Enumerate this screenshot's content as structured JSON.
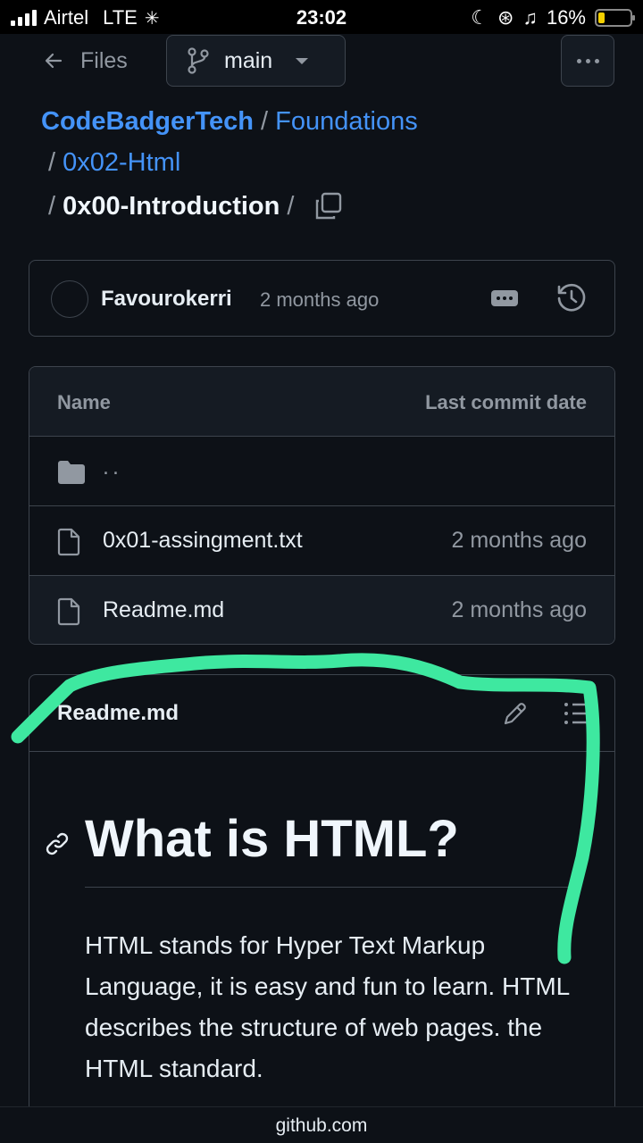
{
  "status_bar": {
    "carrier": "Airtel",
    "network": "LTE",
    "time": "23:02",
    "battery": "16%"
  },
  "nav": {
    "back_label": "Files",
    "branch": "main"
  },
  "breadcrumb": {
    "owner": "CodeBadgerTech",
    "repo": "Foundations",
    "folder": "0x02-Html",
    "current": "0x00-Introduction",
    "separator": "/"
  },
  "commit": {
    "author": "Favourokerri",
    "time": "2 months ago"
  },
  "files": {
    "header_name": "Name",
    "header_date": "Last commit date",
    "parent_dir": "..",
    "rows": [
      {
        "name": "0x01-assingment.txt",
        "date": "2 months ago"
      },
      {
        "name": "Readme.md",
        "date": "2 months ago"
      }
    ]
  },
  "readme": {
    "title": "Readme.md",
    "heading": "What is HTML?",
    "paragraph": "HTML stands for Hyper Text Markup Language, it is easy and fun to learn. HTML describes the structure of web pages. the HTML standard."
  },
  "url_bar": {
    "domain": "github.com"
  },
  "colors": {
    "background": "#0d1117",
    "link": "#4493f8",
    "border": "#3d444d",
    "muted": "#9198a1",
    "annotation": "#3ee8a0"
  }
}
